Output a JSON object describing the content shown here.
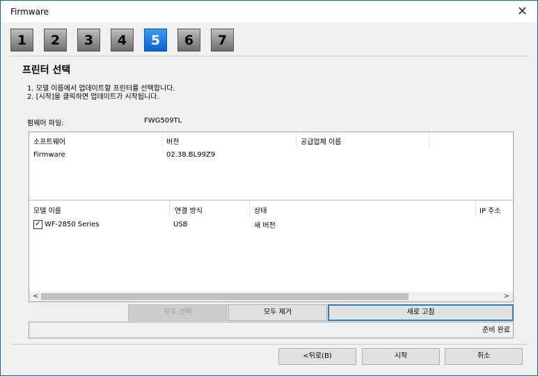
{
  "window": {
    "title": "Firmware"
  },
  "steps": [
    "1",
    "2",
    "3",
    "4",
    "5",
    "6",
    "7"
  ],
  "active_step": "5",
  "page": {
    "title": "프린터 선택",
    "instructions": [
      "1. 모델 이름에서 업데이트할 프린터를 선택합니다.",
      "2. [시작]을 클릭하면 업데이트가 시작됩니다."
    ]
  },
  "firmware_file": {
    "label": "펌웨어 파일:",
    "value": "FWG509TL"
  },
  "software_table": {
    "headers": [
      "소프트웨어",
      "버전",
      "공급업체 이름"
    ],
    "rows": [
      {
        "software": "Firmware",
        "version": "02.38.BL99Z9",
        "vendor": ""
      }
    ]
  },
  "model_table": {
    "headers": [
      "모델 이름",
      "연결 방식",
      "상태",
      "IP 주소"
    ],
    "rows": [
      {
        "checked": true,
        "check_mark": "✓",
        "model": "WF-2850 Series",
        "connection": "USB",
        "status": "새 버전",
        "ip": ""
      }
    ]
  },
  "scroll": {
    "left_arrow": "<",
    "right_arrow": ">"
  },
  "actions": {
    "select_all": "모두 선택",
    "clear_all": "모두 제거",
    "refresh": "새로 고침"
  },
  "status_text": "준비 완료",
  "footer": {
    "back": "<뒤로(B)",
    "start": "시작",
    "cancel": "취소"
  },
  "icons": {
    "close": "✕"
  }
}
